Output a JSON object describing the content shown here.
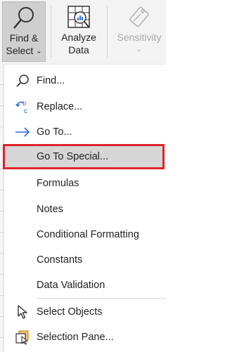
{
  "ribbon": {
    "find_select": {
      "line1": "Find &",
      "line2": "Select",
      "chevron": "⌄",
      "icon": "magnifier-icon"
    },
    "analyze_data": {
      "line1": "Analyze",
      "line2": "Data",
      "icon": "analyze-data-icon"
    },
    "sensitivity": {
      "line1": "Sensitivity",
      "chevron": "⌄",
      "icon": "sensitivity-icon",
      "disabled": true
    }
  },
  "menu": {
    "items": [
      {
        "label": "Find...",
        "icon": "search-icon"
      },
      {
        "label": "Replace...",
        "icon": "replace-icon"
      },
      {
        "label": "Go To...",
        "icon": "arrow-right-icon"
      },
      {
        "label": "Go To Special...",
        "icon": "",
        "highlighted": true
      },
      {
        "label": "Formulas",
        "icon": ""
      },
      {
        "label": "Notes",
        "icon": ""
      },
      {
        "label": "Conditional Formatting",
        "icon": ""
      },
      {
        "label": "Constants",
        "icon": ""
      },
      {
        "label": "Data Validation",
        "icon": ""
      },
      {
        "label": "Select Objects",
        "icon": "pointer-icon"
      },
      {
        "label": "Selection Pane...",
        "icon": "selection-pane-icon"
      }
    ]
  },
  "colors": {
    "highlight_border": "#e0232b",
    "highlight_fill": "#d6d6d6",
    "accent_blue": "#2b6cd4"
  }
}
